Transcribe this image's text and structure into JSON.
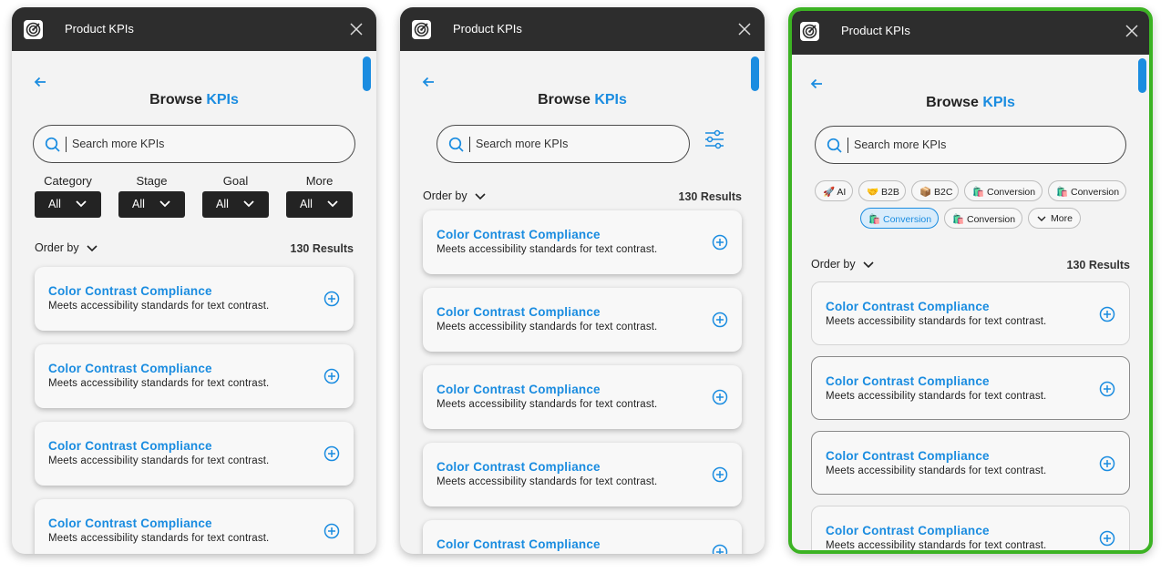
{
  "app": {
    "title": "Product KPIs"
  },
  "heading": {
    "prefix": "Browse",
    "accent": "KPIs"
  },
  "search": {
    "placeholder": "Search more KPIs"
  },
  "filters": [
    {
      "label": "Category",
      "value": "All"
    },
    {
      "label": "Stage",
      "value": "All"
    },
    {
      "label": "Goal",
      "value": "All"
    },
    {
      "label": "More",
      "value": "All"
    }
  ],
  "order_by": "Order by",
  "results": "130 Results",
  "kpi": {
    "title": "Color Contrast Compliance",
    "description": "Meets accessibility standards for text contrast."
  },
  "chips": [
    {
      "label": "🚀 AI"
    },
    {
      "label": "🤝 B2B"
    },
    {
      "label": "📦 B2C"
    },
    {
      "label": "🛍️ Conversion"
    },
    {
      "label": "🛍️ Conversion"
    },
    {
      "label": "🛍️ Conversion",
      "active": true
    },
    {
      "label": "🛍️ Conversion"
    },
    {
      "label": "More"
    }
  ],
  "colors": {
    "accent": "#1a8ce0",
    "titlebar": "#2d2d2d",
    "highlight_border": "#3cb323"
  },
  "icons": [
    "target-app-icon",
    "close-icon",
    "back-arrow-icon",
    "search-icon",
    "chevron-down-icon",
    "plus-circle-icon",
    "sliders-icon"
  ]
}
